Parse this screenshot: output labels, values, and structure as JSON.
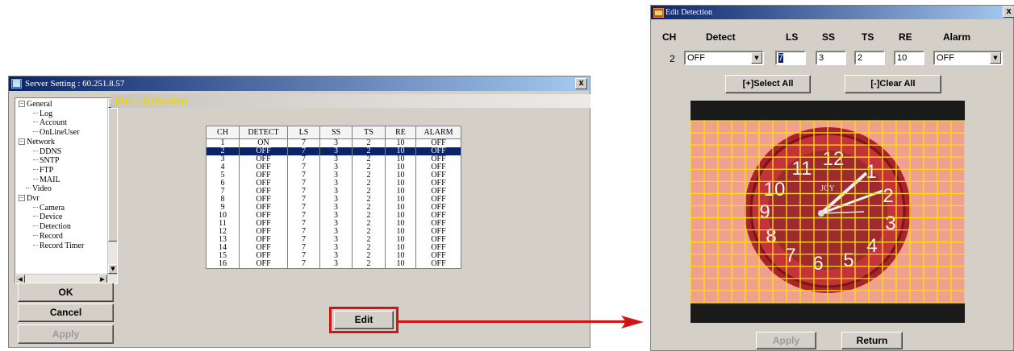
{
  "server_window": {
    "title": "Server Setting : 60.251.8.57",
    "close_label": "x",
    "tree": [
      {
        "label": "General",
        "expander": "−",
        "depth": 0
      },
      {
        "label": "Log",
        "depth": 2
      },
      {
        "label": "Account",
        "depth": 2
      },
      {
        "label": "OnLineUser",
        "depth": 2
      },
      {
        "label": "Network",
        "expander": "−",
        "depth": 0
      },
      {
        "label": "DDNS",
        "depth": 2
      },
      {
        "label": "SNTP",
        "depth": 2
      },
      {
        "label": "FTP",
        "depth": 2
      },
      {
        "label": "MAIL",
        "depth": 2
      },
      {
        "label": "Video",
        "depth": 1
      },
      {
        "label": "Dvr",
        "expander": "−",
        "depth": 0
      },
      {
        "label": "Camera",
        "depth": 2
      },
      {
        "label": "Device",
        "depth": 2
      },
      {
        "label": "Detection",
        "depth": 2
      },
      {
        "label": "Record",
        "depth": 2
      },
      {
        "label": "Record Timer",
        "depth": 2
      }
    ],
    "ok_label": "OK",
    "cancel_label": "Cancel",
    "apply_label": "Apply",
    "section_title": "Dvr :: Detection",
    "table": {
      "headers": [
        "CH",
        "DETECT",
        "LS",
        "SS",
        "TS",
        "RE",
        "ALARM"
      ],
      "selected_row": 2,
      "rows": [
        [
          "1",
          "ON",
          "7",
          "3",
          "2",
          "10",
          "OFF"
        ],
        [
          "2",
          "OFF",
          "7",
          "3",
          "2",
          "10",
          "OFF"
        ],
        [
          "3",
          "OFF",
          "7",
          "3",
          "2",
          "10",
          "OFF"
        ],
        [
          "4",
          "OFF",
          "7",
          "3",
          "2",
          "10",
          "OFF"
        ],
        [
          "5",
          "OFF",
          "7",
          "3",
          "2",
          "10",
          "OFF"
        ],
        [
          "6",
          "OFF",
          "7",
          "3",
          "2",
          "10",
          "OFF"
        ],
        [
          "7",
          "OFF",
          "7",
          "3",
          "2",
          "10",
          "OFF"
        ],
        [
          "8",
          "OFF",
          "7",
          "3",
          "2",
          "10",
          "OFF"
        ],
        [
          "9",
          "OFF",
          "7",
          "3",
          "2",
          "10",
          "OFF"
        ],
        [
          "10",
          "OFF",
          "7",
          "3",
          "2",
          "10",
          "OFF"
        ],
        [
          "11",
          "OFF",
          "7",
          "3",
          "2",
          "10",
          "OFF"
        ],
        [
          "12",
          "OFF",
          "7",
          "3",
          "2",
          "10",
          "OFF"
        ],
        [
          "13",
          "OFF",
          "7",
          "3",
          "2",
          "10",
          "OFF"
        ],
        [
          "14",
          "OFF",
          "7",
          "3",
          "2",
          "10",
          "OFF"
        ],
        [
          "15",
          "OFF",
          "7",
          "3",
          "2",
          "10",
          "OFF"
        ],
        [
          "16",
          "OFF",
          "7",
          "3",
          "2",
          "10",
          "OFF"
        ]
      ]
    },
    "edit_label": "Edit"
  },
  "edit_dialog": {
    "title": "Edit Detection",
    "close_label": "x",
    "headers": {
      "ch": "CH",
      "detect": "Detect",
      "ls": "LS",
      "ss": "SS",
      "ts": "TS",
      "re": "RE",
      "alarm": "Alarm"
    },
    "values": {
      "ch": "2",
      "detect": "OFF",
      "ls": "7",
      "ss": "3",
      "ts": "2",
      "re": "10",
      "alarm": "OFF"
    },
    "select_all_label": "[+]Select All",
    "clear_all_label": "[-]Clear All",
    "apply_label": "Apply",
    "return_label": "Return",
    "clock_brand": "JCY",
    "clock_numbers": [
      "12",
      "1",
      "2",
      "3",
      "4",
      "5",
      "6",
      "7",
      "8",
      "9",
      "10",
      "11"
    ]
  },
  "colors": {
    "highlight": "#d41414",
    "grid": "#ffe000",
    "title_bar": "#0a246a",
    "section_text": "#f0d400"
  },
  "icons": {
    "window": "app-window-icon",
    "dropdown": "chevron-down-icon"
  }
}
